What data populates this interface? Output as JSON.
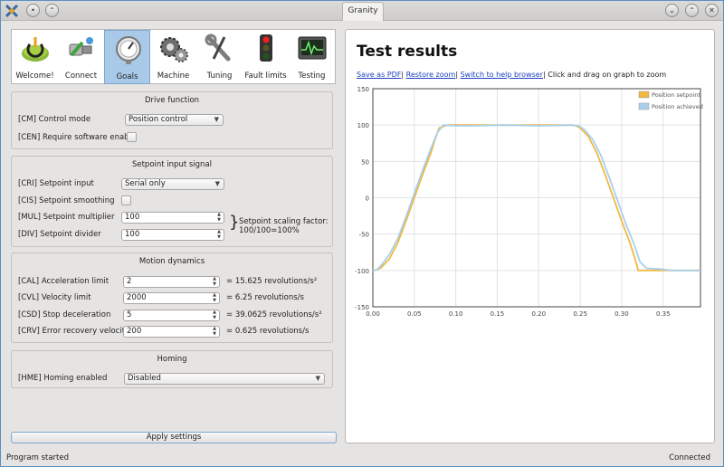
{
  "window": {
    "title": "Granity"
  },
  "toolbar": {
    "tabs": [
      {
        "label": "Welcome!",
        "icon": "power-icon"
      },
      {
        "label": "Connect",
        "icon": "plug-icon"
      },
      {
        "label": "Goals",
        "icon": "gauge-icon",
        "active": true
      },
      {
        "label": "Machine",
        "icon": "gears-icon"
      },
      {
        "label": "Tuning",
        "icon": "wrench-icon"
      },
      {
        "label": "Fault limits",
        "icon": "traffic-light-icon"
      },
      {
        "label": "Testing",
        "icon": "scope-icon"
      }
    ]
  },
  "drive_function": {
    "title": "Drive function",
    "control_mode_label": "[CM] Control mode",
    "control_mode_value": "Position control",
    "require_enable_label": "[CEN] Require software enable"
  },
  "setpoint_input": {
    "title": "Setpoint input signal",
    "input_label": "[CRI] Setpoint input",
    "input_value": "Serial only",
    "smoothing_label": "[CIS] Setpoint smoothing",
    "multiplier_label": "[MUL] Setpoint multiplier",
    "multiplier_value": "100",
    "divider_label": "[DIV] Setpoint divider",
    "divider_value": "100",
    "scaling_note_line1": "Setpoint scaling factor:",
    "scaling_note_line2": "100/100=100%"
  },
  "motion_dynamics": {
    "title": "Motion dynamics",
    "rows": [
      {
        "label": "[CAL] Acceleration limit",
        "value": "2",
        "note": "= 15.625 revolutions/s²"
      },
      {
        "label": "[CVL] Velocity limit",
        "value": "2000",
        "note": "= 6.25 revolutions/s"
      },
      {
        "label": "[CSD] Stop deceleration",
        "value": "5",
        "note": "= 39.0625 revolutions/s²"
      },
      {
        "label": "[CRV] Error recovery velocity",
        "value": "200",
        "note": "= 0.625 revolutions/s"
      }
    ]
  },
  "homing": {
    "title": "Homing",
    "enabled_label": "[HME] Homing enabled",
    "enabled_value": "Disabled"
  },
  "apply_label": "Apply settings",
  "status": {
    "left": "Program started",
    "right": "Connected"
  },
  "results": {
    "title": "Test results",
    "links": [
      "Save as PDF",
      "Restore zoom",
      "Switch to help browser"
    ],
    "hint": "Click and drag on graph to zoom"
  },
  "colors": {
    "setpoint": "#f0b840",
    "achieved": "#a8d0ec",
    "accent": "#a9c9e8"
  },
  "chart_data": {
    "type": "line",
    "x_ticks": [
      "0.00",
      "0.05",
      "0.10",
      "0.15",
      "0.20",
      "0.25",
      "0.30",
      "0.35"
    ],
    "y_ticks": [
      "150",
      "100",
      "50",
      "0",
      "-50",
      "-100",
      "-150"
    ],
    "xlim": [
      0,
      0.395
    ],
    "ylim": [
      -150,
      150
    ],
    "grid": true,
    "legend_position": "top-right",
    "series": [
      {
        "name": "Position setpoint",
        "x": [
          0,
          0.005,
          0.01,
          0.02,
          0.03,
          0.04,
          0.05,
          0.06,
          0.07,
          0.075,
          0.08,
          0.09,
          0.12,
          0.16,
          0.2,
          0.24,
          0.245,
          0.25,
          0.26,
          0.27,
          0.28,
          0.29,
          0.3,
          0.31,
          0.315,
          0.32,
          0.35,
          0.395
        ],
        "y": [
          -100,
          -99,
          -96,
          -84,
          -62,
          -32,
          0,
          32,
          62,
          80,
          96,
          100,
          100,
          100,
          100,
          100,
          99,
          96,
          84,
          62,
          32,
          0,
          -32,
          -62,
          -80,
          -100,
          -100,
          -100
        ]
      },
      {
        "name": "Position achieved",
        "x": [
          0,
          0.005,
          0.01,
          0.02,
          0.03,
          0.04,
          0.05,
          0.06,
          0.07,
          0.078,
          0.085,
          0.1,
          0.12,
          0.16,
          0.2,
          0.24,
          0.248,
          0.255,
          0.265,
          0.275,
          0.285,
          0.295,
          0.305,
          0.315,
          0.322,
          0.33,
          0.345,
          0.36,
          0.395
        ],
        "y": [
          -100,
          -99,
          -93,
          -78,
          -56,
          -26,
          6,
          38,
          68,
          90,
          100,
          99,
          99,
          100,
          99,
          100,
          99,
          94,
          80,
          58,
          28,
          -4,
          -36,
          -64,
          -88,
          -97,
          -98,
          -100,
          -100
        ]
      }
    ]
  }
}
